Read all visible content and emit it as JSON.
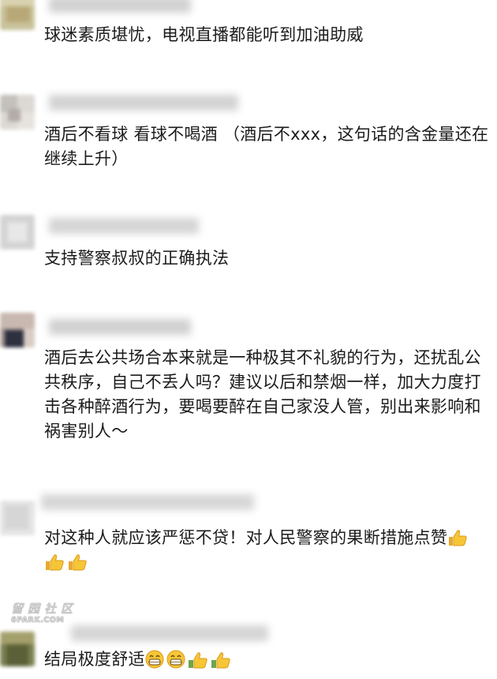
{
  "comments": [
    {
      "text": "球迷素质堪忧，电视直播都能听到加油助威"
    },
    {
      "text": "酒后不看球 看球不喝酒 （酒后不xxx，这句话的含金量还在继续上升）"
    },
    {
      "text": "支持警察叔叔的正确执法"
    },
    {
      "text": "酒后去公共场合本来就是一种极其不礼貌的行为，还扰乱公共秩序，自己不丢人吗？建议以后和禁烟一样，加大力度打击各种醉酒行为，要喝要醉在自己家没人管，别出来影响和祸害别人～"
    },
    {
      "text": "对这种人就应该严惩不贷！对人民警察的果断措施点赞"
    },
    {
      "text": "结局极度舒适"
    }
  ],
  "emoji": {
    "thumbs_up": "thumbs-up-icon",
    "grin": "grinning-face-icon",
    "skin_thumb": "thumbs-up-icon"
  },
  "colors": {
    "text": "#1b1b1b",
    "emoji_yellow": "#f7c637",
    "emoji_green": "#6fa64a",
    "blur_gray": "#c9c9c9"
  },
  "watermark": {
    "cn": "留园社区",
    "en": "6PARK.COM"
  }
}
